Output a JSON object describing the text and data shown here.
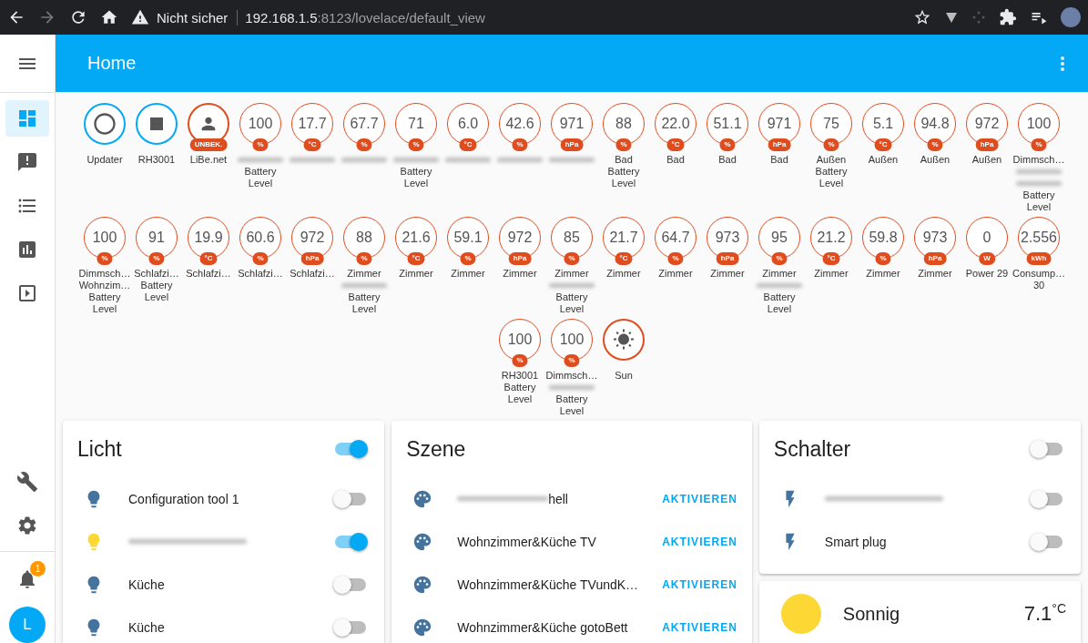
{
  "browser": {
    "security": "Nicht sicher",
    "host": "192.168.1.5",
    "path": ":8123/lovelace/default_view"
  },
  "sidebar": {
    "items": [
      {
        "selected": true
      },
      {
        "selected": false
      },
      {
        "selected": false
      },
      {
        "selected": false
      },
      {
        "selected": false
      }
    ],
    "notifications": {
      "count": "1"
    },
    "user": {
      "initial": "L"
    }
  },
  "header": {
    "title": "Home"
  },
  "badges": [
    {
      "kind": "ring",
      "color": "#03a9f4",
      "lines": [
        {
          "text": "Updater"
        }
      ]
    },
    {
      "kind": "square",
      "color": "#03a9f4",
      "lines": [
        {
          "text": "RH3001"
        }
      ]
    },
    {
      "kind": "person",
      "tag": "UNBEK.",
      "color": "#df4c1e",
      "lines": [
        {
          "text": "LiBe.net"
        }
      ]
    },
    {
      "kind": "value",
      "value": "100",
      "unit": "%",
      "color": "#df4c1e",
      "lines": [
        {
          "kind": "blur"
        },
        {
          "text": "Battery"
        },
        {
          "text": "Level"
        }
      ]
    },
    {
      "kind": "value",
      "value": "17.7",
      "unit": "°C",
      "color": "#df4c1e",
      "lines": [
        {
          "kind": "blur"
        }
      ]
    },
    {
      "kind": "value",
      "value": "67.7",
      "unit": "%",
      "color": "#df4c1e",
      "lines": [
        {
          "kind": "blur"
        }
      ]
    },
    {
      "kind": "value",
      "value": "71",
      "unit": "%",
      "color": "#df4c1e",
      "lines": [
        {
          "kind": "blur"
        },
        {
          "text": "Battery"
        },
        {
          "text": "Level"
        }
      ]
    },
    {
      "kind": "value",
      "value": "6.0",
      "unit": "°C",
      "color": "#df4c1e",
      "lines": [
        {
          "kind": "blur"
        }
      ]
    },
    {
      "kind": "value",
      "value": "42.6",
      "unit": "%",
      "color": "#df4c1e",
      "lines": [
        {
          "kind": "blur"
        }
      ]
    },
    {
      "kind": "value",
      "value": "971",
      "unit": "hPa",
      "color": "#df4c1e",
      "lines": [
        {
          "kind": "blur"
        }
      ]
    },
    {
      "kind": "value",
      "value": "88",
      "unit": "%",
      "color": "#df4c1e",
      "lines": [
        {
          "text": "Bad"
        },
        {
          "text": "Battery"
        },
        {
          "text": "Level"
        }
      ]
    },
    {
      "kind": "value",
      "value": "22.0",
      "unit": "°C",
      "color": "#df4c1e",
      "lines": [
        {
          "text": "Bad"
        }
      ]
    },
    {
      "kind": "value",
      "value": "51.1",
      "unit": "%",
      "color": "#df4c1e",
      "lines": [
        {
          "text": "Bad"
        }
      ]
    },
    {
      "kind": "value",
      "value": "971",
      "unit": "hPa",
      "color": "#df4c1e",
      "lines": [
        {
          "text": "Bad"
        }
      ]
    },
    {
      "kind": "value",
      "value": "75",
      "unit": "%",
      "color": "#df4c1e",
      "lines": [
        {
          "text": "Außen"
        },
        {
          "text": "Battery"
        },
        {
          "text": "Level"
        }
      ]
    },
    {
      "kind": "value",
      "value": "5.1",
      "unit": "°C",
      "color": "#df4c1e",
      "lines": [
        {
          "text": "Außen"
        }
      ]
    },
    {
      "kind": "value",
      "value": "94.8",
      "unit": "%",
      "color": "#df4c1e",
      "lines": [
        {
          "text": "Außen"
        }
      ]
    },
    {
      "kind": "value",
      "value": "972",
      "unit": "hPa",
      "color": "#df4c1e",
      "lines": [
        {
          "text": "Außen"
        }
      ]
    },
    {
      "kind": "value",
      "value": "100",
      "unit": "%",
      "color": "#df4c1e",
      "lines": [
        {
          "text": "Dimmsch…"
        },
        {
          "kind": "blur"
        },
        {
          "kind": "blur"
        },
        {
          "text": "Battery"
        },
        {
          "text": "Level"
        }
      ]
    },
    {
      "kind": "value",
      "value": "100",
      "unit": "%",
      "color": "#df4c1e",
      "lines": [
        {
          "text": "Dimmsch…"
        },
        {
          "text": "Wohnzim…"
        },
        {
          "text": "Battery"
        },
        {
          "text": "Level"
        }
      ]
    },
    {
      "kind": "value",
      "value": "91",
      "unit": "%",
      "color": "#df4c1e",
      "lines": [
        {
          "text": "Schlafzi…"
        },
        {
          "text": "Battery"
        },
        {
          "text": "Level"
        }
      ]
    },
    {
      "kind": "value",
      "value": "19.9",
      "unit": "°C",
      "color": "#df4c1e",
      "lines": [
        {
          "text": "Schlafzi…"
        }
      ]
    },
    {
      "kind": "value",
      "value": "60.6",
      "unit": "%",
      "color": "#df4c1e",
      "lines": [
        {
          "text": "Schlafzi…"
        }
      ]
    },
    {
      "kind": "value",
      "value": "972",
      "unit": "hPa",
      "color": "#df4c1e",
      "lines": [
        {
          "text": "Schlafzi…"
        }
      ]
    },
    {
      "kind": "value",
      "value": "88",
      "unit": "%",
      "color": "#df4c1e",
      "lines": [
        {
          "text": "Zimmer"
        },
        {
          "kind": "blur"
        },
        {
          "text": "Battery"
        },
        {
          "text": "Level"
        }
      ]
    },
    {
      "kind": "value",
      "value": "21.6",
      "unit": "°C",
      "color": "#df4c1e",
      "lines": [
        {
          "text": "Zimmer"
        }
      ]
    },
    {
      "kind": "value",
      "value": "59.1",
      "unit": "%",
      "color": "#df4c1e",
      "lines": [
        {
          "text": "Zimmer"
        }
      ]
    },
    {
      "kind": "value",
      "value": "972",
      "unit": "hPa",
      "color": "#df4c1e",
      "lines": [
        {
          "text": "Zimmer"
        }
      ]
    },
    {
      "kind": "value",
      "value": "85",
      "unit": "%",
      "color": "#df4c1e",
      "lines": [
        {
          "text": "Zimmer"
        },
        {
          "kind": "blur"
        },
        {
          "text": "Battery"
        },
        {
          "text": "Level"
        }
      ]
    },
    {
      "kind": "value",
      "value": "21.7",
      "unit": "°C",
      "color": "#df4c1e",
      "lines": [
        {
          "text": "Zimmer"
        }
      ]
    },
    {
      "kind": "value",
      "value": "64.7",
      "unit": "%",
      "color": "#df4c1e",
      "lines": [
        {
          "text": "Zimmer"
        }
      ]
    },
    {
      "kind": "value",
      "value": "973",
      "unit": "hPa",
      "color": "#df4c1e",
      "lines": [
        {
          "text": "Zimmer"
        }
      ]
    },
    {
      "kind": "value",
      "value": "95",
      "unit": "%",
      "color": "#df4c1e",
      "lines": [
        {
          "text": "Zimmer"
        },
        {
          "kind": "blur"
        },
        {
          "text": "Battery"
        },
        {
          "text": "Level"
        }
      ]
    },
    {
      "kind": "value",
      "value": "21.2",
      "unit": "°C",
      "color": "#df4c1e",
      "lines": [
        {
          "text": "Zimmer"
        }
      ]
    },
    {
      "kind": "value",
      "value": "59.8",
      "unit": "%",
      "color": "#df4c1e",
      "lines": [
        {
          "text": "Zimmer"
        }
      ]
    },
    {
      "kind": "value",
      "value": "973",
      "unit": "hPa",
      "color": "#df4c1e",
      "lines": [
        {
          "text": "Zimmer"
        }
      ]
    },
    {
      "kind": "value",
      "value": "0",
      "unit": "W",
      "color": "#df4c1e",
      "lines": [
        {
          "text": "Power 29"
        }
      ]
    },
    {
      "kind": "value",
      "value": "2.556",
      "unit": "kWh",
      "color": "#df4c1e",
      "lines": [
        {
          "text": "Consump…"
        },
        {
          "text": "30"
        }
      ]
    },
    {
      "kind": "value",
      "value": "100",
      "unit": "%",
      "color": "#df4c1e",
      "lines": [
        {
          "text": "RH3001"
        },
        {
          "text": "Battery"
        },
        {
          "text": "Level"
        }
      ]
    },
    {
      "kind": "value",
      "value": "100",
      "unit": "%",
      "color": "#df4c1e",
      "lines": [
        {
          "text": "Dimmsch…"
        },
        {
          "kind": "blur"
        },
        {
          "text": "Battery"
        },
        {
          "text": "Level"
        }
      ]
    },
    {
      "kind": "sun",
      "color": "#df4c1e",
      "lines": [
        {
          "text": "Sun"
        }
      ]
    }
  ],
  "cards": [
    {
      "kind": "lights",
      "title": "Licht",
      "on": true,
      "rows": [
        {
          "name": "Configuration tool 1",
          "on": false
        },
        {
          "blurred": true,
          "on": true
        },
        {
          "name": "Küche",
          "on": false
        },
        {
          "name": "Küche",
          "on": false
        }
      ]
    },
    {
      "kind": "scenes",
      "title": "Szene",
      "rows": [
        {
          "name": "hell",
          "blurred": true,
          "action": "AKTIVIEREN"
        },
        {
          "name": "Wohnzimmer&Küche TV",
          "action": "AKTIVIEREN"
        },
        {
          "name": "Wohnzimmer&Küche TVundK…",
          "action": "AKTIVIEREN"
        },
        {
          "name": "Wohnzimmer&Küche gotoBett",
          "action": "AKTIVIEREN"
        }
      ]
    },
    {
      "kind": "switches",
      "title": "Schalter",
      "on": false,
      "rows": [
        {
          "blurred": true,
          "on": false
        },
        {
          "name": "Smart plug",
          "on": false
        }
      ]
    }
  ],
  "weather": {
    "condition": "Sonnig",
    "temperature": "7.1",
    "unit": "°C"
  }
}
